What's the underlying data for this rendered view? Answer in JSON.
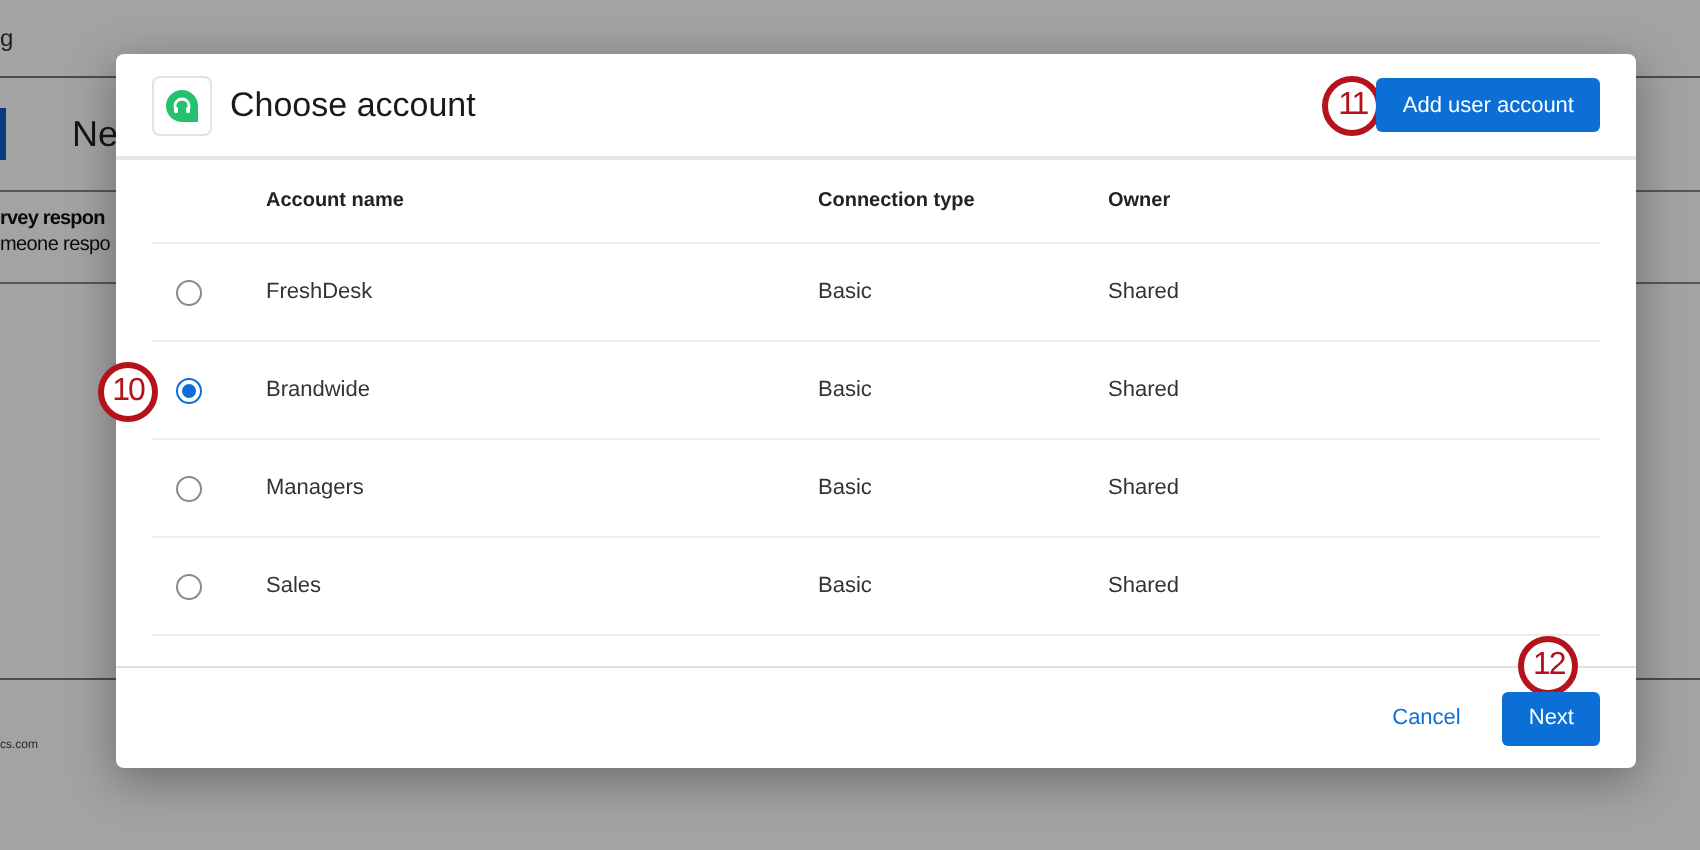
{
  "background": {
    "header_text": "g",
    "heading": "Ne",
    "notice_title": "rvey respon",
    "notice_text": "meone respo",
    "footer_text": "cs.com"
  },
  "dialog": {
    "title": "Choose account",
    "add_button": {
      "label": "Add user account",
      "callout": "11"
    },
    "columns": [
      "Account name",
      "Connection type",
      "Owner"
    ],
    "rows": [
      {
        "name": "FreshDesk",
        "connection": "Basic",
        "owner": "Shared",
        "selected": false
      },
      {
        "name": "Brandwide",
        "connection": "Basic",
        "owner": "Shared",
        "selected": true,
        "callout": "10"
      },
      {
        "name": "Managers",
        "connection": "Basic",
        "owner": "Shared",
        "selected": false
      },
      {
        "name": "Sales",
        "connection": "Basic",
        "owner": "Shared",
        "selected": false
      }
    ],
    "cancel": "Cancel",
    "next_button": {
      "label": "Next",
      "callout": "12"
    }
  }
}
